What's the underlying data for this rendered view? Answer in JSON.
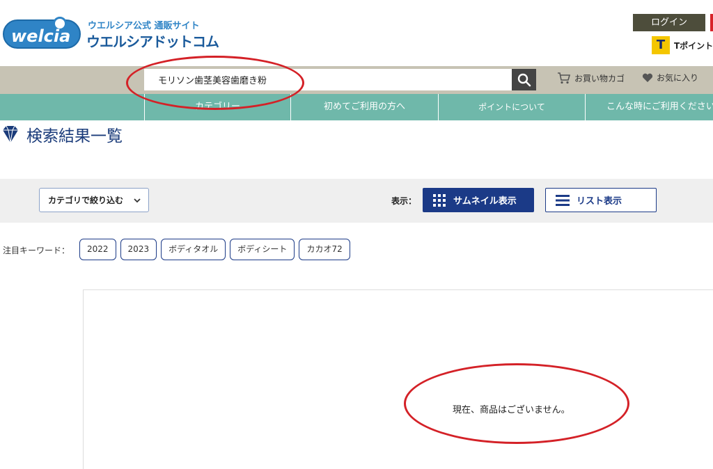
{
  "logo": {
    "brand": "welcia",
    "tagline": "ウエルシア公式 通販サイト",
    "name": "ウエルシアドットコム"
  },
  "header": {
    "login_label": "ログイン",
    "tpoint_icon": "T",
    "tpoint_label": "Tポイント"
  },
  "search": {
    "value": "モリソン歯茎美容歯磨き粉",
    "placeholder": ""
  },
  "header_links": {
    "cart_label": "お買い物カゴ",
    "favorites_label": "お気に入り"
  },
  "nav": {
    "items": [
      "カテゴリー",
      "初めてご利用の方へ",
      "ポイントについて",
      "こんな時にご利用ください"
    ]
  },
  "page_title": "検索結果一覧",
  "filter": {
    "category_label": "カテゴリで絞り込む",
    "view_label": "表示：",
    "thumbnail_label": "サムネイル表示",
    "list_label": "リスト表示"
  },
  "keywords": {
    "label": "注目キーワード：",
    "items": [
      "2022",
      "2023",
      "ボディタオル",
      "ボディシート",
      "カカオ72"
    ]
  },
  "results": {
    "empty_message": "現在、商品はございません。"
  },
  "colors": {
    "brand_blue": "#2f84c6",
    "nav_green": "#6fb8aa",
    "search_strip": "#c7c3b4",
    "accent_navy": "#1b3a87",
    "annotation_red": "#d42127"
  },
  "icons": {
    "search": "magnifier-icon",
    "cart": "cart-icon",
    "favorite": "heart-icon",
    "title": "diamond-icon",
    "thumbnail": "grid-icon",
    "list": "list-icon"
  }
}
